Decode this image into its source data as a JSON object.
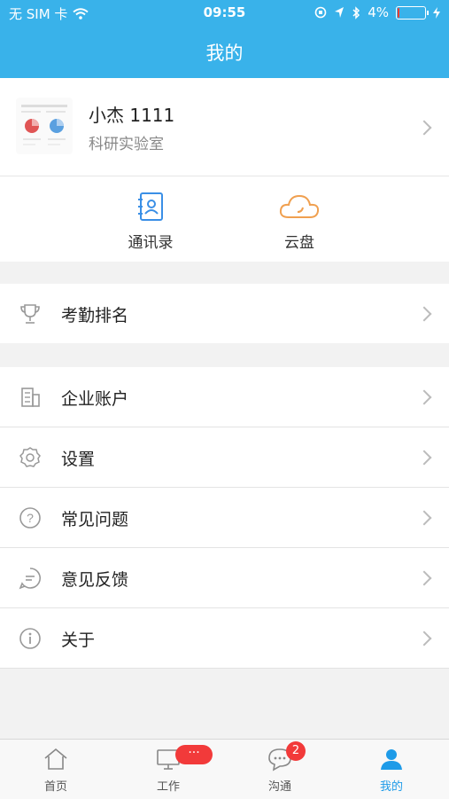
{
  "status": {
    "carrier": "无 SIM 卡",
    "time": "09:55",
    "battery": "4%",
    "battery_level": 0.04
  },
  "header": {
    "title": "我的"
  },
  "profile": {
    "name": "小杰   1111",
    "department": "科研实验室"
  },
  "quick_actions": [
    {
      "label": "通讯录",
      "icon": "contacts-book-icon",
      "color": "#3a8fe6"
    },
    {
      "label": "云盘",
      "icon": "cloud-icon",
      "color": "#f0a050"
    }
  ],
  "menu": {
    "group1": [
      {
        "label": "考勤排名",
        "icon": "trophy-icon"
      }
    ],
    "group2": [
      {
        "label": "企业账户",
        "icon": "building-icon"
      },
      {
        "label": "设置",
        "icon": "gear-icon"
      },
      {
        "label": "常见问题",
        "icon": "question-icon"
      },
      {
        "label": "意见反馈",
        "icon": "feedback-icon"
      },
      {
        "label": "关于",
        "icon": "info-icon"
      }
    ]
  },
  "tabs": [
    {
      "label": "首页",
      "icon": "home-icon"
    },
    {
      "label": "工作",
      "icon": "monitor-icon",
      "badge": "···"
    },
    {
      "label": "沟通",
      "icon": "chat-icon",
      "badge": "2"
    },
    {
      "label": "我的",
      "icon": "user-icon",
      "active": true
    }
  ],
  "colors": {
    "accent": "#39b2ea",
    "active_tab": "#1e9be8",
    "badge": "#f23a3a"
  }
}
